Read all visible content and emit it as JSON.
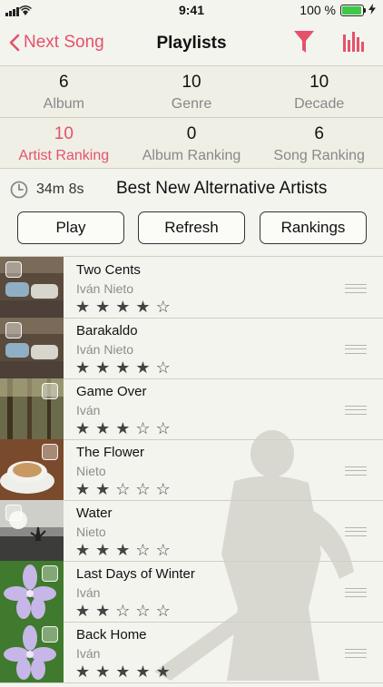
{
  "status": {
    "time": "9:41",
    "battery": "100 %",
    "battery_level": 1.0
  },
  "nav": {
    "back_label": "Next Song",
    "title": "Playlists"
  },
  "summary": [
    {
      "count": "6",
      "label": "Album",
      "active": false
    },
    {
      "count": "10",
      "label": "Genre",
      "active": false
    },
    {
      "count": "10",
      "label": "Decade",
      "active": false
    },
    {
      "count": "10",
      "label": "Artist Ranking",
      "active": true
    },
    {
      "count": "0",
      "label": "Album Ranking",
      "active": false
    },
    {
      "count": "6",
      "label": "Song Ranking",
      "active": false
    }
  ],
  "playlist": {
    "duration": "34m 8s",
    "name": "Best New Alternative Artists"
  },
  "buttons": {
    "play": "Play",
    "refresh": "Refresh",
    "rankings": "Rankings"
  },
  "songs": [
    {
      "title": "Two Cents",
      "artist": "Iván Nieto",
      "rating": 4,
      "thumb": "cars"
    },
    {
      "title": "Barakaldo",
      "artist": "Iván Nieto",
      "rating": 4,
      "thumb": "cars"
    },
    {
      "title": "Game Over",
      "artist": "Iván",
      "rating": 3,
      "thumb": "forest"
    },
    {
      "title": "The Flower",
      "artist": "Nieto",
      "rating": 2,
      "thumb": "coffee"
    },
    {
      "title": "Water",
      "artist": "Nieto",
      "rating": 3,
      "thumb": "sea"
    },
    {
      "title": "Last Days of Winter",
      "artist": "Iván",
      "rating": 2,
      "thumb": "flower"
    },
    {
      "title": "Back Home",
      "artist": "Iván",
      "rating": 5,
      "thumb": "flower"
    }
  ],
  "colors": {
    "accent": "#e4526a",
    "background": "#f4f4ef"
  }
}
